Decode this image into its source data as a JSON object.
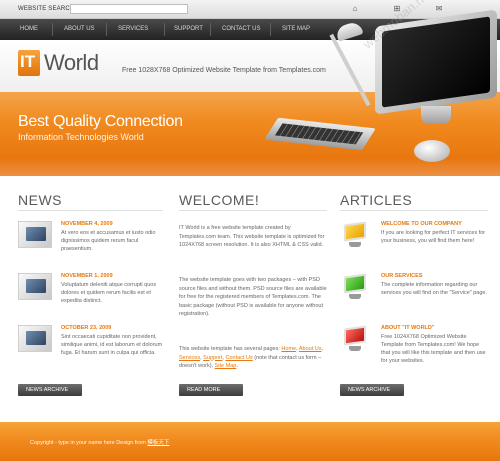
{
  "search": {
    "label": "WEBSITE SEARCH:",
    "placeholder": "",
    "value": ""
  },
  "top_icons": [
    "home-icon",
    "sitemap-icon",
    "mail-icon"
  ],
  "nav": {
    "items": [
      "HOME",
      "ABOUT US",
      "SERVICES",
      "SUPPORT",
      "CONTACT US",
      "SITE MAP"
    ]
  },
  "header": {
    "logo_mark": "IT",
    "logo_text": "World",
    "tagline": "Free 1028X768 Optimized Website Template from Templates.com"
  },
  "banner": {
    "title": "Best Quality Connection",
    "subtitle": "Information Technologies World"
  },
  "news": {
    "title": "NEWS",
    "items": [
      {
        "date": "NOVEMBER 4, 2009",
        "text": "At vero eos et accusamus et iusto odio dignissimos quidem rerum facul praesentium."
      },
      {
        "date": "NOVEMBER 1, 2009",
        "text": "Voluptatum deleniti atque corrupti quos dolores et quidem rerum facilis est et expedita distinct."
      },
      {
        "date": "OCTOBER 23, 2009",
        "text": "Sint occaecati cupiditate non provident, similique animi, id est laborum et dolorum fuga. Et harum sunt in culpa qui officia."
      }
    ],
    "button": "NEWS ARCHIVE"
  },
  "welcome": {
    "title": "WELCOME!",
    "para1": "IT World is a free website template created by Templates.com team. This website template is optimized for 1024X768 screen resolution. It is also XHTML & CSS valid.",
    "para2": "The website template goes with two packages – with PSD source files and without them. PSD source files are available for free for the registered members of Templates.com. The basic package (without PSD is available for anyone without registration).",
    "para3_start": "This website template has several pages: ",
    "links": [
      "Home",
      "About Us",
      "Services",
      "Support",
      "Contact Us"
    ],
    "para3_mid": " (note that contact us form – doesn't work), ",
    "link_sitemap": "Site Map",
    "para3_end": ".",
    "button": "READ MORE"
  },
  "articles": {
    "title": "ARTICLES",
    "items": [
      {
        "title": "WELCOME TO OUR COMPANY",
        "text": "If you are looking for perfect IT services for your business, you will find them here!",
        "color": "#f2b705"
      },
      {
        "title": "OUR SERVICES",
        "text": "The complete information regarding our services you will find on the \"Service\" page.",
        "color": "#3fb21a"
      },
      {
        "title": "ABOUT \"IT WORLD\"",
        "text": "Free 1024X768 Optimized Website Template from Templates.com! We hope that you will like this template and then use for your websites.",
        "color": "#d61f1f"
      }
    ],
    "button": "NEWS ARCHIVE"
  },
  "footer": {
    "text": "Copyright - type in your name here Design from ",
    "link": "模板天下"
  },
  "watermark": "webmoban.net",
  "colors": {
    "accent": "#e8780b",
    "nav_bg": "#2f2f2f",
    "banner": "#f08a1f"
  }
}
